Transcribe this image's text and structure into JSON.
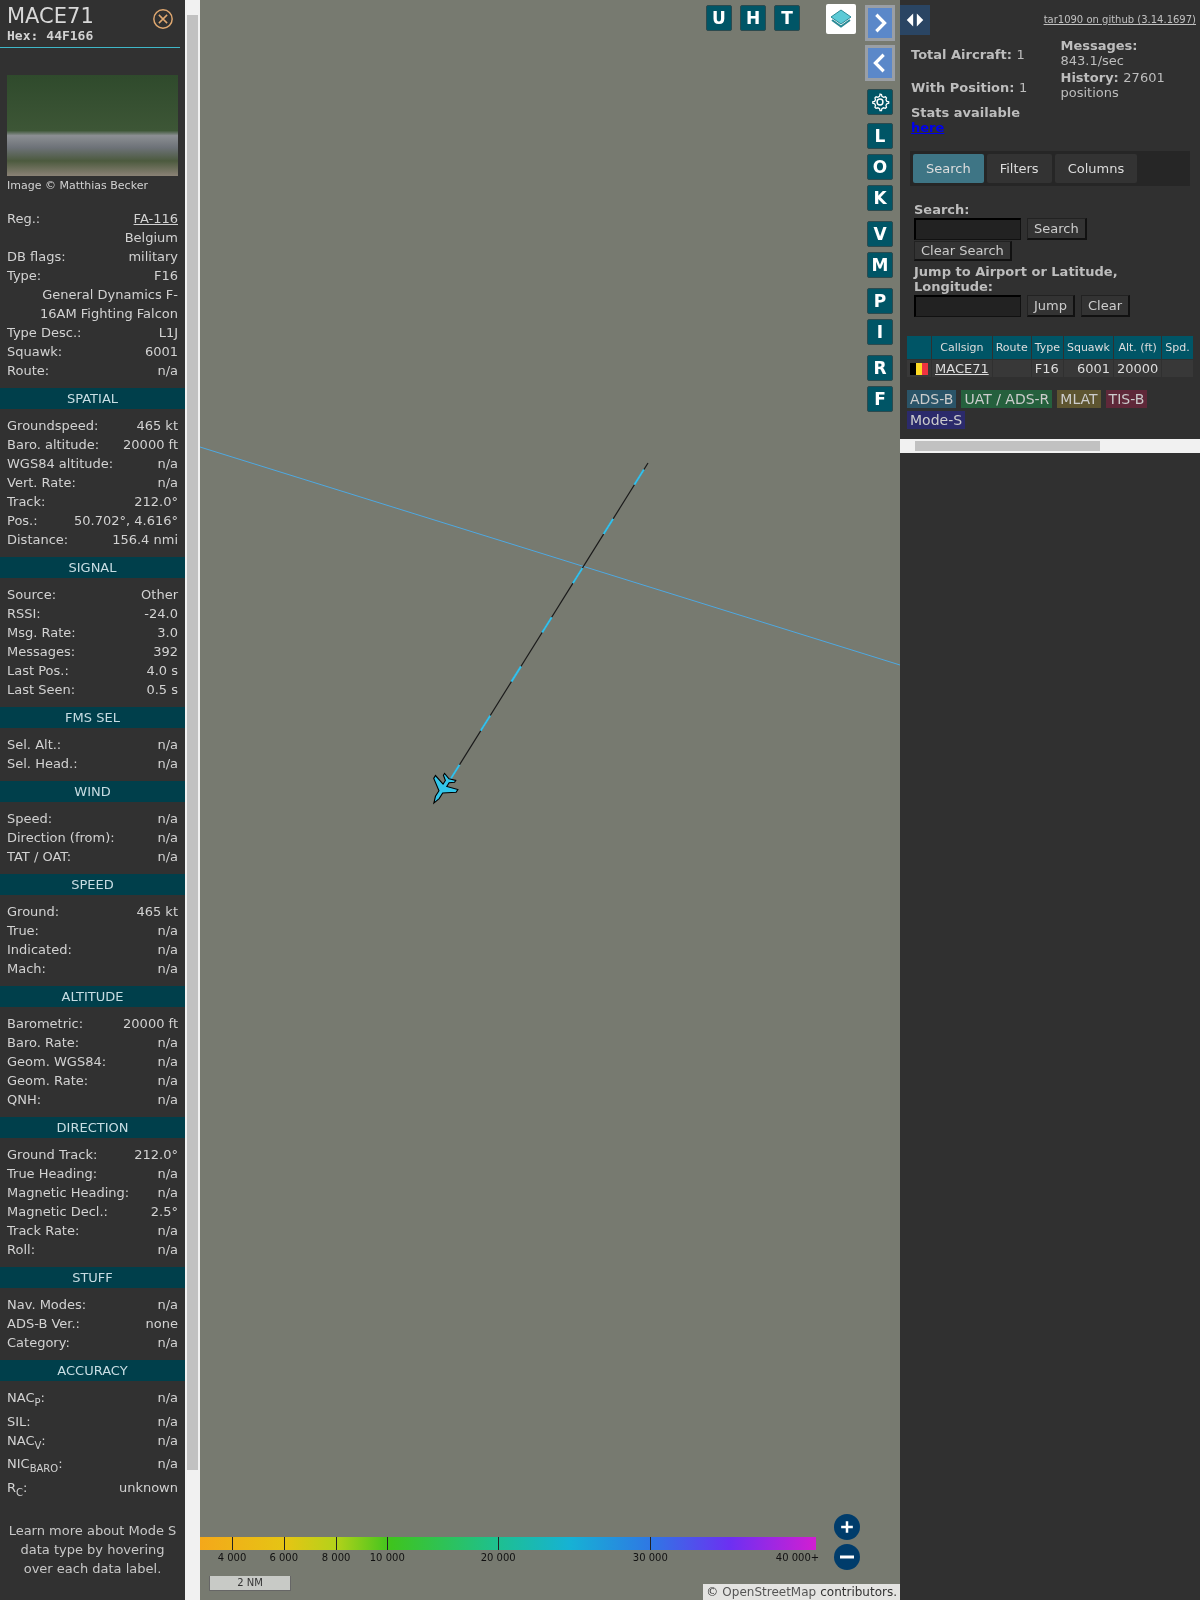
{
  "sidebar": {
    "callsign": "MACE71",
    "hex_label": "Hex:",
    "hex": "44F166",
    "photo_credit": "Image © Matthias Becker",
    "details": [
      {
        "label": "Reg.:",
        "value": "FA-116",
        "kind": "link"
      },
      {
        "value": "Belgium",
        "kind": "text"
      },
      {
        "label": "DB flags:",
        "value": "military",
        "kind": "text"
      },
      {
        "label": "Type:",
        "value": "F16",
        "kind": "text"
      },
      {
        "value": "General Dynamics F-16AM Fighting Falcon",
        "kind": "text"
      },
      {
        "label": "Type Desc.:",
        "value": "L1J",
        "kind": "text"
      },
      {
        "label": "Squawk:",
        "value": "6001",
        "kind": "text"
      },
      {
        "label": "Route:",
        "value": "n/a",
        "kind": "text"
      }
    ],
    "sections": [
      {
        "title": "SPATIAL",
        "rows": [
          {
            "label": "Groundspeed:",
            "value": "465 kt"
          },
          {
            "label": "Baro. altitude:",
            "value": "20000 ft"
          },
          {
            "label": "WGS84 altitude:",
            "value": "n/a"
          },
          {
            "label": "Vert. Rate:",
            "value": "n/a"
          },
          {
            "label": "Track:",
            "value": "212.0°"
          },
          {
            "label": "Pos.:",
            "value": "50.702°, 4.616°"
          },
          {
            "label": "Distance:",
            "value": "156.4 nmi"
          }
        ]
      },
      {
        "title": "SIGNAL",
        "rows": [
          {
            "label": "Source:",
            "value": "Other"
          },
          {
            "label": "RSSI:",
            "value": "-24.0"
          },
          {
            "label": "Msg. Rate:",
            "value": "3.0"
          },
          {
            "label": "Messages:",
            "value": "392"
          },
          {
            "label": "Last Pos.:",
            "value": "4.0 s"
          },
          {
            "label": "Last Seen:",
            "value": "0.5 s"
          }
        ]
      },
      {
        "title": "FMS SEL",
        "rows": [
          {
            "label": "Sel. Alt.:",
            "value": "n/a"
          },
          {
            "label": "Sel. Head.:",
            "value": "n/a"
          }
        ]
      },
      {
        "title": "WIND",
        "rows": [
          {
            "label": "Speed:",
            "value": "n/a"
          },
          {
            "label": "Direction (from):",
            "value": "n/a"
          },
          {
            "label": "TAT / OAT:",
            "value": "n/a"
          }
        ]
      },
      {
        "title": "SPEED",
        "rows": [
          {
            "label": "Ground:",
            "value": "465 kt"
          },
          {
            "label": "True:",
            "value": "n/a"
          },
          {
            "label": "Indicated:",
            "value": "n/a"
          },
          {
            "label": "Mach:",
            "value": "n/a"
          }
        ]
      },
      {
        "title": "ALTITUDE",
        "rows": [
          {
            "label": "Barometric:",
            "value": "20000 ft"
          },
          {
            "label": "Baro. Rate:",
            "value": "n/a"
          },
          {
            "label": "Geom. WGS84:",
            "value": "n/a"
          },
          {
            "label": "Geom. Rate:",
            "value": "n/a"
          },
          {
            "label": "QNH:",
            "value": "n/a"
          }
        ]
      },
      {
        "title": "DIRECTION",
        "rows": [
          {
            "label": "Ground Track:",
            "value": "212.0°"
          },
          {
            "label": "True Heading:",
            "value": "n/a"
          },
          {
            "label": "Magnetic Heading:",
            "value": "n/a"
          },
          {
            "label": "Magnetic Decl.:",
            "value": "2.5°"
          },
          {
            "label": "Track Rate:",
            "value": "n/a"
          },
          {
            "label": "Roll:",
            "value": "n/a"
          }
        ]
      },
      {
        "title": "STUFF",
        "rows": [
          {
            "label": "Nav. Modes:",
            "value": "n/a"
          },
          {
            "label": "ADS-B Ver.:",
            "value": "none"
          },
          {
            "label": "Category:",
            "value": "n/a"
          }
        ]
      },
      {
        "title": "ACCURACY",
        "rows": [
          {
            "label": "NAC$_{P}$:",
            "value": "n/a"
          },
          {
            "label": "SIL:",
            "value": "n/a"
          },
          {
            "label": "NAC$_{V}$:",
            "value": "n/a"
          },
          {
            "label": "NIC$_{BARO}$:",
            "value": "n/a"
          },
          {
            "label": "R$_{C}$:",
            "value": "unknown"
          }
        ]
      }
    ],
    "note": "Learn more about Mode S data type by hovering over each data label."
  },
  "map": {
    "top_buttons": [
      "U",
      "H",
      "T"
    ],
    "side_button_groups": [
      [
        "L",
        "O",
        "K"
      ],
      [
        "V",
        "M"
      ],
      [
        "P",
        "I"
      ],
      [
        "R",
        "F"
      ]
    ],
    "altitude_legend": [
      "4 000",
      "6 000",
      "8 000",
      "10 000",
      "20 000",
      "30 000",
      "40 000+"
    ],
    "scale": "2 NM",
    "attribution": {
      "prefix": "©",
      "link": "OpenStreetMap",
      "suffix": "contributors."
    }
  },
  "panel": {
    "github_link": "tar1090 on github (3.14.1697)",
    "stats_left": [
      {
        "label": "Total Aircraft:",
        "value": "1"
      },
      {
        "label": "With Position:",
        "value": "1"
      }
    ],
    "stats_right": [
      {
        "label": "Messages:",
        "value": "843.1/sec"
      },
      {
        "label": "History:",
        "value": "27601 positions"
      }
    ],
    "stats_note": "Stats available",
    "stats_link": "here",
    "tabs": [
      {
        "label": "Search",
        "selected": true
      },
      {
        "label": "Filters",
        "selected": false
      },
      {
        "label": "Columns",
        "selected": false
      }
    ],
    "search": {
      "label": "Search:",
      "button": "Search",
      "clear_button": "Clear Search",
      "jump_label": "Jump to Airport or Latitude, Longitude:",
      "jump_button": "Jump",
      "jump_clear_button": "Clear"
    },
    "table": {
      "columns": [
        "Callsign",
        "Route",
        "Type",
        "Squawk",
        "Alt. (ft)",
        "Spd."
      ],
      "rows": [
        {
          "callsign": "MACE71",
          "type": "F16",
          "squawk": "6001",
          "altitude": "20000"
        }
      ]
    },
    "legend": [
      {
        "label": "ADS-B",
        "color": "#2a5468"
      },
      {
        "label": "UAT / ADS-R",
        "color": "#25603d"
      },
      {
        "label": "MLAT",
        "color": "#5e5530"
      },
      {
        "label": "TIS-B",
        "color": "#5f2839"
      },
      {
        "label": "Mode-S",
        "color": "#2b2a6b"
      }
    ]
  }
}
